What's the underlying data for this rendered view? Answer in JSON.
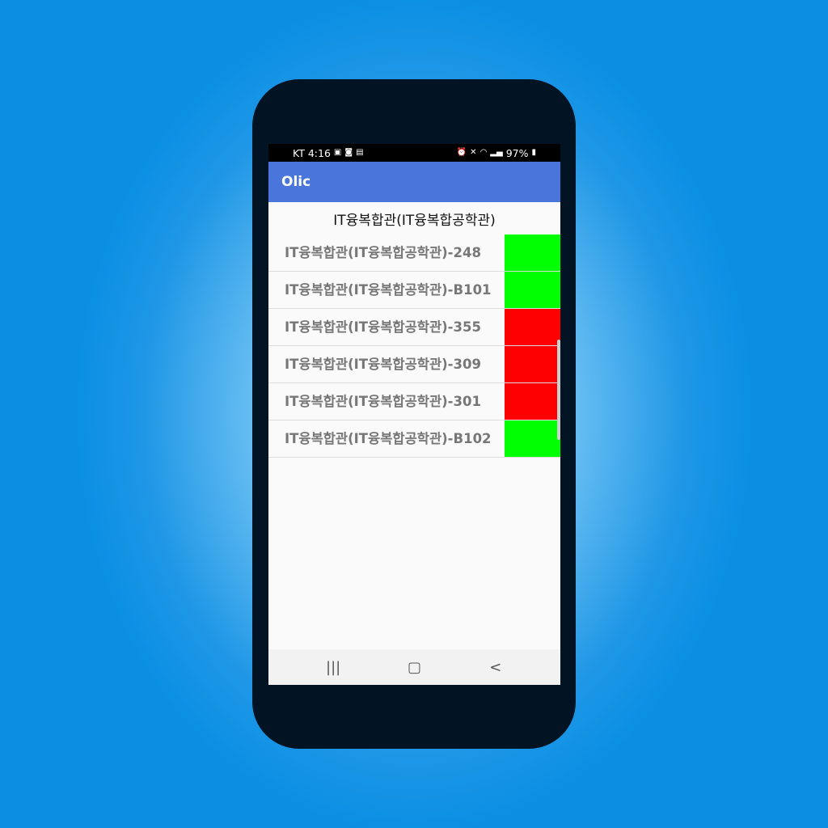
{
  "status_bar": {
    "carrier_time": "KT 4:16",
    "left_icons": [
      "image-icon",
      "app-notification-icon",
      "search-doc-icon"
    ],
    "right_icons": [
      "alarm-icon",
      "mute-icon",
      "hd-icon",
      "wifi-icon",
      "signal-icon"
    ],
    "battery": "97%"
  },
  "app_bar": {
    "title": "Olic"
  },
  "heading": "IT융복합관(IT융복합공학관)",
  "rooms": [
    {
      "label": "IT융복합관(IT융복합공학관)-248",
      "status_color": "#00ff00"
    },
    {
      "label": "IT융복합관(IT융복합공학관)-B101",
      "status_color": "#00ff00"
    },
    {
      "label": "IT융복합관(IT융복합공학관)-355",
      "status_color": "#ff0000"
    },
    {
      "label": "IT융복합관(IT융복합공학관)-309",
      "status_color": "#ff0000"
    },
    {
      "label": "IT융복합관(IT융복합공학관)-301",
      "status_color": "#ff0000"
    },
    {
      "label": "IT융복합관(IT융복합공학관)-B102",
      "status_color": "#00ff00"
    }
  ],
  "nav_bar": {
    "recents_glyph": "|||",
    "home_glyph": "▢",
    "back_glyph": "<"
  },
  "colors": {
    "app_bar": "#4a76db",
    "available": "#00ff00",
    "occupied": "#ff0000"
  }
}
